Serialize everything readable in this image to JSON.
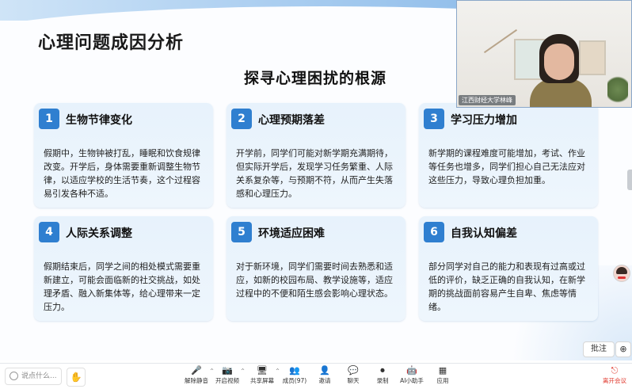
{
  "slide": {
    "title": "心理问题成因分析",
    "subtitle": "探寻心理困扰的根源",
    "cards": [
      {
        "num": "1",
        "title": "生物节律变化",
        "body": "假期中，生物钟被打乱，睡眠和饮食规律改变。开学后，身体需要重新调整生物节律，以适应学校的生活节奏，这个过程容易引发各种不适。"
      },
      {
        "num": "2",
        "title": "心理预期落差",
        "body": "开学前，同学们可能对新学期充满期待，但实际开学后，发现学习任务繁重、人际关系复杂等，与预期不符，从而产生失落感和心理压力。"
      },
      {
        "num": "3",
        "title": "学习压力增加",
        "body": "新学期的课程难度可能增加，考试、作业等任务也增多，同学们担心自己无法应对这些压力，导致心理负担加重。"
      },
      {
        "num": "4",
        "title": "人际关系调整",
        "body": "假期结束后，同学之间的相处模式需要重新建立，可能会面临新的社交挑战，如处理矛盾、融入新集体等，给心理带来一定压力。"
      },
      {
        "num": "5",
        "title": "环境适应困难",
        "body": "对于新环境，同学们需要时间去熟悉和适应，如新的校园布局、教学设施等，适应过程中的不便和陌生感会影响心理状态。"
      },
      {
        "num": "6",
        "title": "自我认知偏差",
        "body": "部分同学对自己的能力和表现有过高或过低的评价，缺乏正确的自我认知，在新学期的挑战面前容易产生自卑、焦虑等情绪。"
      }
    ]
  },
  "video": {
    "name_tag": "江西财经大学林峰"
  },
  "side": {
    "annotate_label": "批注",
    "zoom_icon": "⊕"
  },
  "toolbar": {
    "say_placeholder": "说点什么...",
    "hand_icon": "✋",
    "items": [
      {
        "label": "解除静音",
        "glyph": "🎤",
        "caret": "^"
      },
      {
        "label": "开启视频",
        "glyph": "📷",
        "caret": "^"
      },
      {
        "label": "共享屏幕",
        "glyph": "🖥",
        "caret": "^"
      },
      {
        "label": "成员(97)",
        "glyph": "👥",
        "caret": ""
      },
      {
        "label": "邀请",
        "glyph": "👤",
        "caret": ""
      },
      {
        "label": "聊天",
        "glyph": "💬",
        "caret": ""
      },
      {
        "label": "录制",
        "glyph": "⏺",
        "caret": ""
      },
      {
        "label": "AI小助手",
        "glyph": "🤖",
        "caret": ""
      },
      {
        "label": "应用",
        "glyph": "▦",
        "caret": ""
      }
    ],
    "leave_label": "离开会议",
    "leave_glyph": "⎋"
  },
  "colors": {
    "accent": "#2f7fd0",
    "card_bg": "#e7f2fc",
    "leave": "#e03a2f"
  }
}
